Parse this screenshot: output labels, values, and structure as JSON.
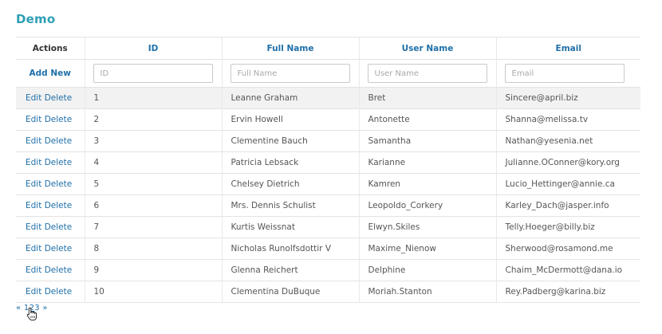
{
  "title": "Demo",
  "columns": {
    "actions": "Actions",
    "id": "ID",
    "full_name": "Full Name",
    "user_name": "User Name",
    "email": "Email"
  },
  "filters": {
    "add_new": "Add New",
    "id_placeholder": "ID",
    "full_name_placeholder": "Full Name",
    "user_name_placeholder": "User Name",
    "email_placeholder": "Email"
  },
  "row_actions": {
    "edit": "Edit",
    "delete": "Delete"
  },
  "rows": [
    {
      "id": "1",
      "full_name": "Leanne Graham",
      "user_name": "Bret",
      "email": "Sincere@april.biz"
    },
    {
      "id": "2",
      "full_name": "Ervin Howell",
      "user_name": "Antonette",
      "email": "Shanna@melissa.tv"
    },
    {
      "id": "3",
      "full_name": "Clementine Bauch",
      "user_name": "Samantha",
      "email": "Nathan@yesenia.net"
    },
    {
      "id": "4",
      "full_name": "Patricia Lebsack",
      "user_name": "Karianne",
      "email": "Julianne.OConner@kory.org"
    },
    {
      "id": "5",
      "full_name": "Chelsey Dietrich",
      "user_name": "Kamren",
      "email": "Lucio_Hettinger@annie.ca"
    },
    {
      "id": "6",
      "full_name": "Mrs. Dennis Schulist",
      "user_name": "Leopoldo_Corkery",
      "email": "Karley_Dach@jasper.info"
    },
    {
      "id": "7",
      "full_name": "Kurtis Weissnat",
      "user_name": "Elwyn.Skiles",
      "email": "Telly.Hoeger@billy.biz"
    },
    {
      "id": "8",
      "full_name": "Nicholas Runolfsdottir V",
      "user_name": "Maxime_Nienow",
      "email": "Sherwood@rosamond.me"
    },
    {
      "id": "9",
      "full_name": "Glenna Reichert",
      "user_name": "Delphine",
      "email": "Chaim_McDermott@dana.io"
    },
    {
      "id": "10",
      "full_name": "Clementina DuBuque",
      "user_name": "Moriah.Stanton",
      "email": "Rey.Padberg@karina.biz"
    }
  ],
  "pagination": {
    "prev": "«",
    "pages": [
      "1",
      "2",
      "3"
    ],
    "current": "2",
    "next": "»"
  },
  "icons": {
    "cursor": "hand-pointer-icon"
  },
  "colors": {
    "title": "#2f9fb5",
    "link": "#1f6fa8",
    "row_hover": "#f2f2f2"
  }
}
